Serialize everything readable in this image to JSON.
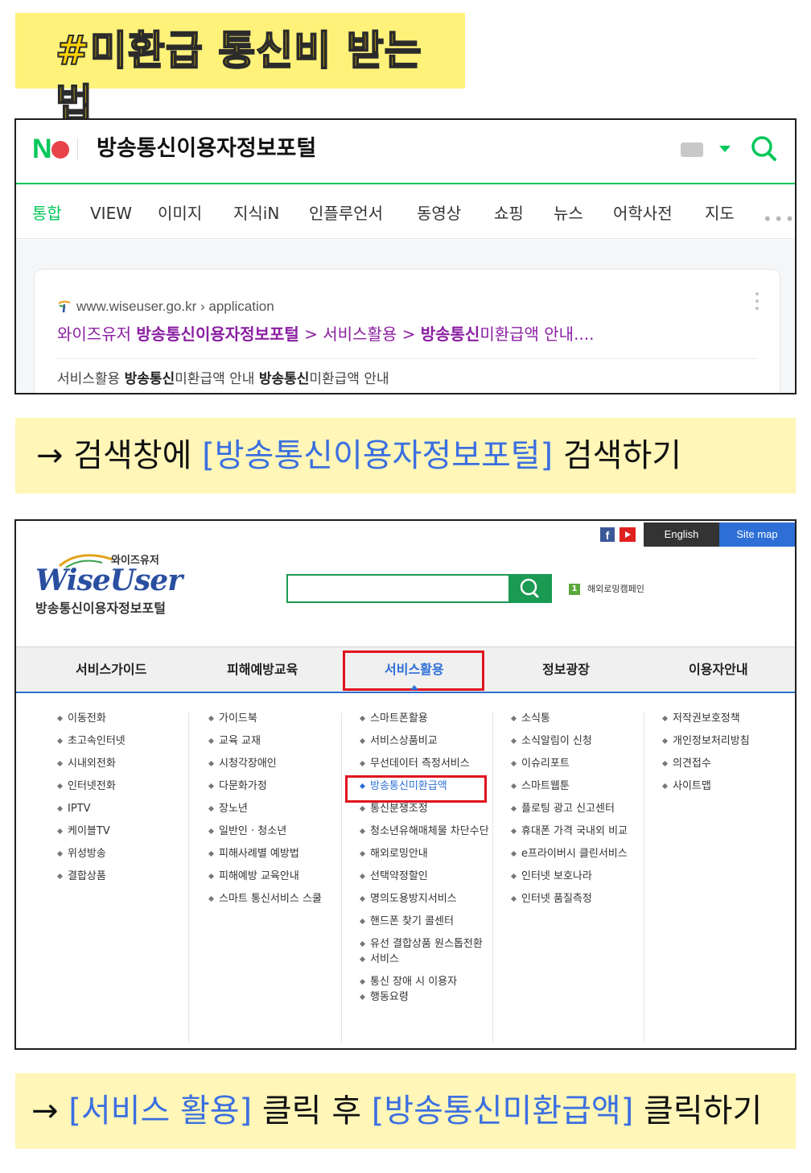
{
  "title": "#미환급 통신비 받는 법",
  "naver": {
    "query": "방송통신이용자정보포털",
    "tabs": [
      "통합",
      "VIEW",
      "이미지",
      "지식iN",
      "인플루언서",
      "동영상",
      "쇼핑",
      "뉴스",
      "어학사전",
      "지도"
    ],
    "more": "•••",
    "result": {
      "url": "www.wiseuser.go.kr › application",
      "link_pre": "와이즈유저 ",
      "link_b1": "방송통신이용자정보포털",
      "link_mid": " > 서비스활용 > ",
      "link_b2": "방송통신",
      "link_post": "미환급액 안내....",
      "desc_pre": "서비스활용 ",
      "desc_b1": "방송통신",
      "desc_mid": "미환급액 안내 ",
      "desc_b2": "방송통신",
      "desc_post": "미환급액 안내"
    }
  },
  "instruction1": {
    "arrow": "→ 검색창에 ",
    "highlight": "[방송통신이용자정보포털]",
    "rest": " 검색하기"
  },
  "wise": {
    "fb": "f",
    "english": "English",
    "sitemap": "Site map",
    "logo_kr": "와이즈유저",
    "logo_en": "WiseUser",
    "logo_sub": "방송통신이용자정보포털",
    "rank_num": "1",
    "rank_text": "해외로밍캠페인",
    "nav": [
      "서비스가이드",
      "피해예방교육",
      "서비스활용",
      "정보광장",
      "이용자안내"
    ],
    "menu": {
      "col1": [
        "이동전화",
        "초고속인터넷",
        "시내외전화",
        "인터넷전화",
        "IPTV",
        "케이블TV",
        "위성방송",
        "결합상품"
      ],
      "col2": [
        "가이드북",
        "교육 교재",
        "시청각장애인",
        "다문화가정",
        "장노년",
        "일반인 · 청소년",
        "피해사례별 예방법",
        "피해예방 교육안내",
        "스마트 통신서비스 스쿨"
      ],
      "col3": [
        "스마트폰활용",
        "서비스상품비교",
        "무선데이터 측정서비스",
        "방송통신미환급액",
        "통신분쟁조정",
        "청소년유해매체물 차단수단",
        "해외로밍안내",
        "선택약정할인",
        "명의도용방지서비스",
        "핸드폰 찾기 콜센터",
        "유선 결합상품 원스톱전환",
        "서비스",
        "통신 장애 시 이용자",
        "행동요령"
      ],
      "col4": [
        "소식통",
        "소식알림이 신청",
        "이슈리포트",
        "스마트웹툰",
        "플로팅 광고 신고센터",
        "휴대폰 가격 국내외 비교",
        "e프라이버시 클린서비스",
        "인터넷 보호나라",
        "인터넷 품질측정"
      ],
      "col5": [
        "저작권보호정책",
        "개인정보처리방침",
        "의견접수",
        "사이트맵"
      ]
    }
  },
  "instruction2": {
    "arrow": "→ ",
    "highlight1": "[서비스 활용]",
    "mid": " 클릭 후 ",
    "highlight2": "[방송통신미환급액]",
    "rest": " 클릭하기"
  },
  "colors": {
    "naver_green": "#03c75a",
    "link_purple": "#8b1fa1",
    "highlight_blue": "#3b6fe0",
    "red_box": "#e0121e",
    "title_yellow": "#ffd400"
  }
}
